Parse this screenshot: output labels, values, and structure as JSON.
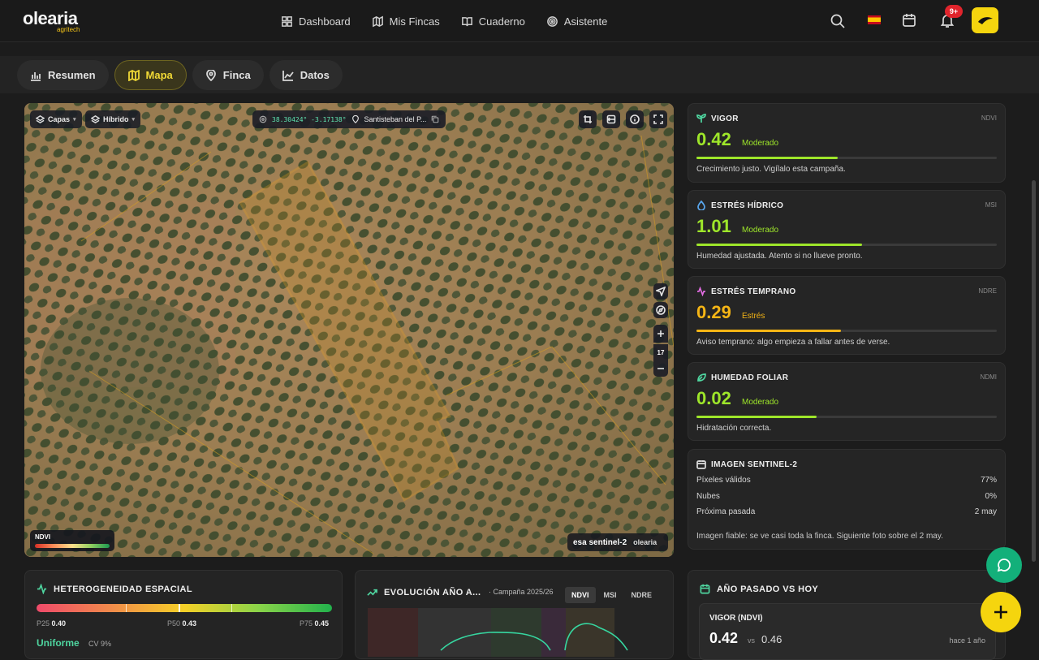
{
  "brand": {
    "name": "olearia",
    "tagline": "agritech"
  },
  "nav": {
    "items": [
      {
        "label": "Dashboard"
      },
      {
        "label": "Mis Fincas"
      },
      {
        "label": "Cuaderno"
      },
      {
        "label": "Asistente"
      }
    ]
  },
  "header": {
    "notifications_badge": "9+",
    "language": "es",
    "accent": "#f5d50e"
  },
  "tabs": [
    {
      "label": "Resumen"
    },
    {
      "label": "Mapa",
      "active": true
    },
    {
      "label": "Finca"
    },
    {
      "label": "Datos"
    }
  ],
  "map": {
    "layers_label": "Capas",
    "basemap_label": "Híbrido",
    "coords": "38.30424° -3.17138°",
    "location": "Santisteban del P...",
    "zoom": "17",
    "legend_title": "NDVI",
    "attribution": "esa sentinel-2",
    "attribution_brand": "olearia"
  },
  "indices": [
    {
      "title": "VIGOR",
      "code": "NDVI",
      "value": "0.42",
      "level": "Moderado",
      "fraction": 0.47,
      "color": "#9ee62a",
      "desc": "Crecimiento justo. Vigílalo esta campaña."
    },
    {
      "title": "ESTRÉS HÍDRICO",
      "code": "MSI",
      "value": "1.01",
      "level": "Moderado",
      "fraction": 0.55,
      "color": "#9ee62a",
      "desc": "Humedad ajustada. Atento si no llueve pronto."
    },
    {
      "title": "ESTRÉS TEMPRANO",
      "code": "NDRE",
      "value": "0.29",
      "level": "Estrés",
      "fraction": 0.48,
      "color": "#f5b515",
      "desc": "Aviso temprano: algo empieza a fallar antes de verse."
    },
    {
      "title": "HUMEDAD FOLIAR",
      "code": "NDMI",
      "value": "0.02",
      "level": "Moderado",
      "fraction": 0.4,
      "color": "#9ee62a",
      "desc": "Hidratación correcta."
    }
  ],
  "sentinel": {
    "title": "IMAGEN SENTINEL-2",
    "rows": [
      {
        "label": "Píxeles válidos",
        "value": "77%"
      },
      {
        "label": "Nubes",
        "value": "0%"
      },
      {
        "label": "Próxima pasada",
        "value": "2 may"
      }
    ],
    "note": "Imagen fiable: se ve casi toda la finca. Siguiente foto sobre el 2 may."
  },
  "heterogeneity": {
    "title": "HETEROGENEIDAD ESPACIAL",
    "p25_label": "P25",
    "p25": "0.40",
    "p50_label": "P50",
    "p50": "0.43",
    "p75_label": "P75",
    "p75": "0.45",
    "class": "Uniforme",
    "cv": "CV 9%"
  },
  "evolution": {
    "title": "EVOLUCIÓN AÑO A...",
    "season": "· Campaña 2025/26",
    "options": [
      "NDVI",
      "MSI",
      "NDRE"
    ],
    "selected": "NDVI"
  },
  "comparison": {
    "title": "AÑO PASADO VS HOY",
    "metric": "VIGOR (NDVI)",
    "current": "0.42",
    "vs": "vs",
    "previous": "0.46",
    "ago": "hace 1 año"
  }
}
